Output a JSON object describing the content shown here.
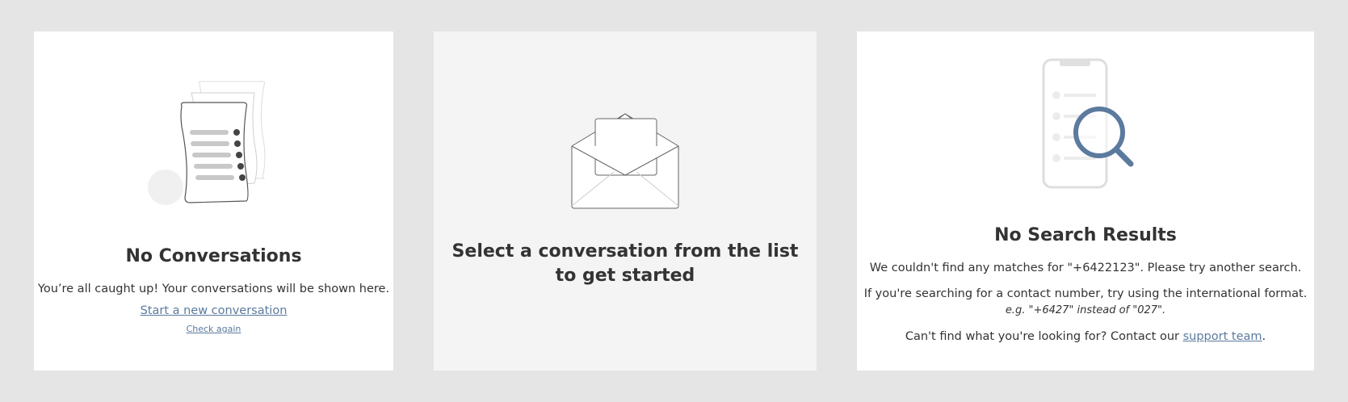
{
  "no_conversations": {
    "title": "No Conversations",
    "subtitle": "You’re all caught up! Your conversations will be shown here.",
    "start_link": "Start a new conversation",
    "check_link": "Check again",
    "illustration_icon": "document-checklist-icon"
  },
  "select_conversation": {
    "title": "Select a conversation from the list to get started",
    "illustration_icon": "open-envelope-icon"
  },
  "no_search_results": {
    "title": "No Search Results",
    "message": "We couldn't find any matches for \"+6422123\". Please try another search.",
    "hint": "If you're searching for a contact number, try using the international format.",
    "example": "e.g. \"+6427\" instead of \"027\".",
    "contact_prefix": "Can't find what you're looking for? Contact our ",
    "support_link": "support team",
    "contact_suffix": ".",
    "illustration_icon": "phone-search-icon"
  },
  "colors": {
    "background": "#e5e5e5",
    "card": "#ffffff",
    "card_selected": "#f4f4f4",
    "link": "#5b7a9e",
    "magnifier": "#5b7a9e"
  }
}
